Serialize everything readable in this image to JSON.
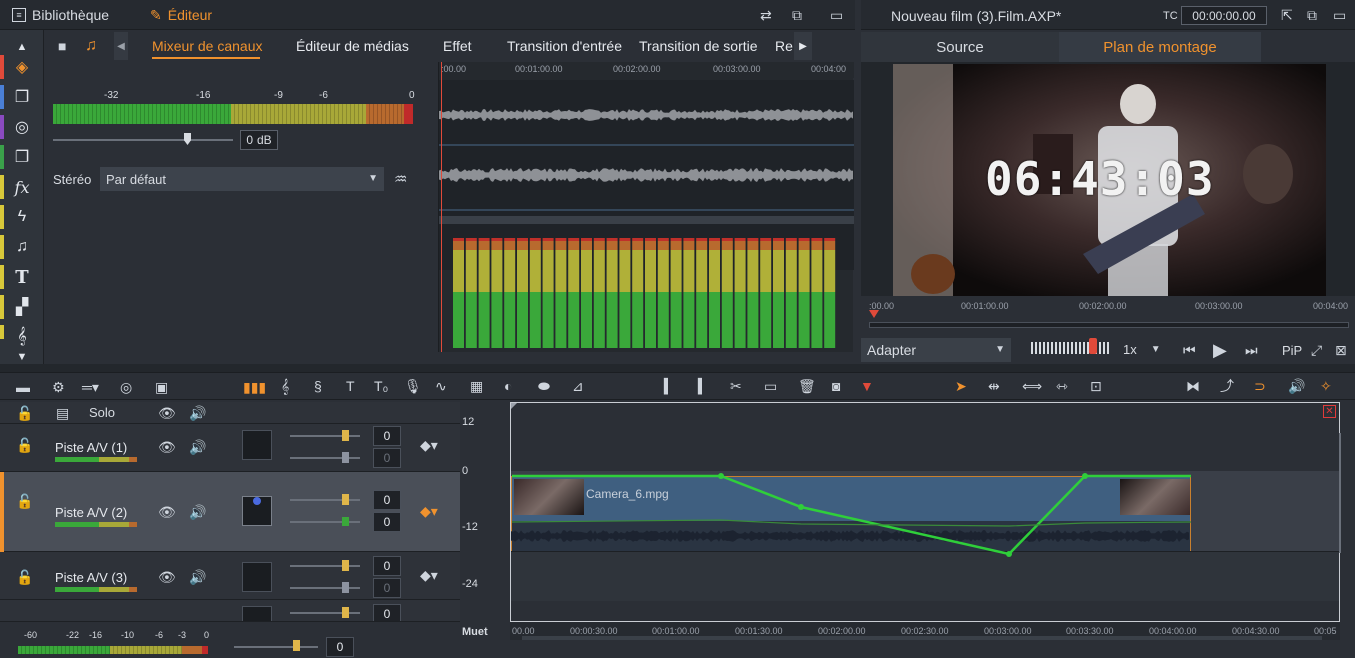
{
  "topbar": {
    "library_label": "Bibliothèque",
    "editor_label": "Éditeur",
    "project_title": "Nouveau film (3).Film.AXP*",
    "tc_label": "TC",
    "timecode": "00:00:00.00"
  },
  "editor_tabs": [
    {
      "label": "Mixeur de canaux",
      "active": true
    },
    {
      "label": "Éditeur de médias",
      "active": false
    },
    {
      "label": "Effet",
      "active": false
    },
    {
      "label": "Transition d'entrée",
      "active": false
    },
    {
      "label": "Transition de sortie",
      "active": false
    },
    {
      "label": "Re",
      "active": false
    }
  ],
  "mixer": {
    "scale": [
      "-32",
      "-16",
      "-9",
      "-6",
      "0"
    ],
    "gain_value": "0",
    "gain_unit": "dB",
    "stereo_label": "Stéréo",
    "stereo_value": "Par défaut"
  },
  "wave_ruler": [
    ":00.00",
    "00:01:00.00",
    "00:02:00.00",
    "00:03:00.00",
    "00:04:00"
  ],
  "preview": {
    "tab_source": "Source",
    "tab_plan": "Plan de montage",
    "overlay_time": "06:43:03",
    "ruler": [
      ":00.00",
      "00:01:00.00",
      "00:02:00.00",
      "00:03:00.00",
      "00:04:00"
    ],
    "fit_value": "Adapter",
    "speed_value": "1x",
    "pip_label": "PiP"
  },
  "tracks": {
    "solo_label": "Solo",
    "items": [
      {
        "name": "Piste A/V (1)",
        "vol": "0",
        "pan": "0"
      },
      {
        "name": "Piste A/V (2)",
        "vol": "0",
        "pan": "0"
      },
      {
        "name": "Piste A/V (3)",
        "vol": "0",
        "pan": "0"
      },
      {
        "name": "",
        "vol": "0",
        "pan": ""
      }
    ],
    "level_scale": [
      "12",
      "0",
      "-12",
      "-24"
    ],
    "mute_label": "Muet"
  },
  "master": {
    "scale": [
      "-60",
      "-22",
      "-16",
      "-10",
      "-6",
      "-3",
      "0"
    ],
    "value": "0"
  },
  "clip": {
    "name": "Camera_6.mpg"
  },
  "timeline_ruler": [
    "00.00",
    "00:00:30.00",
    "00:01:00.00",
    "00:01:30.00",
    "00:02:00.00",
    "00:02:30.00",
    "00:03:00.00",
    "00:03:30.00",
    "00:04:00.00",
    "00:04:30.00",
    "00:05"
  ],
  "colors": {
    "accent": "#f0922e",
    "envelope": "#2fcf3a",
    "clip": "#3a5a78"
  }
}
